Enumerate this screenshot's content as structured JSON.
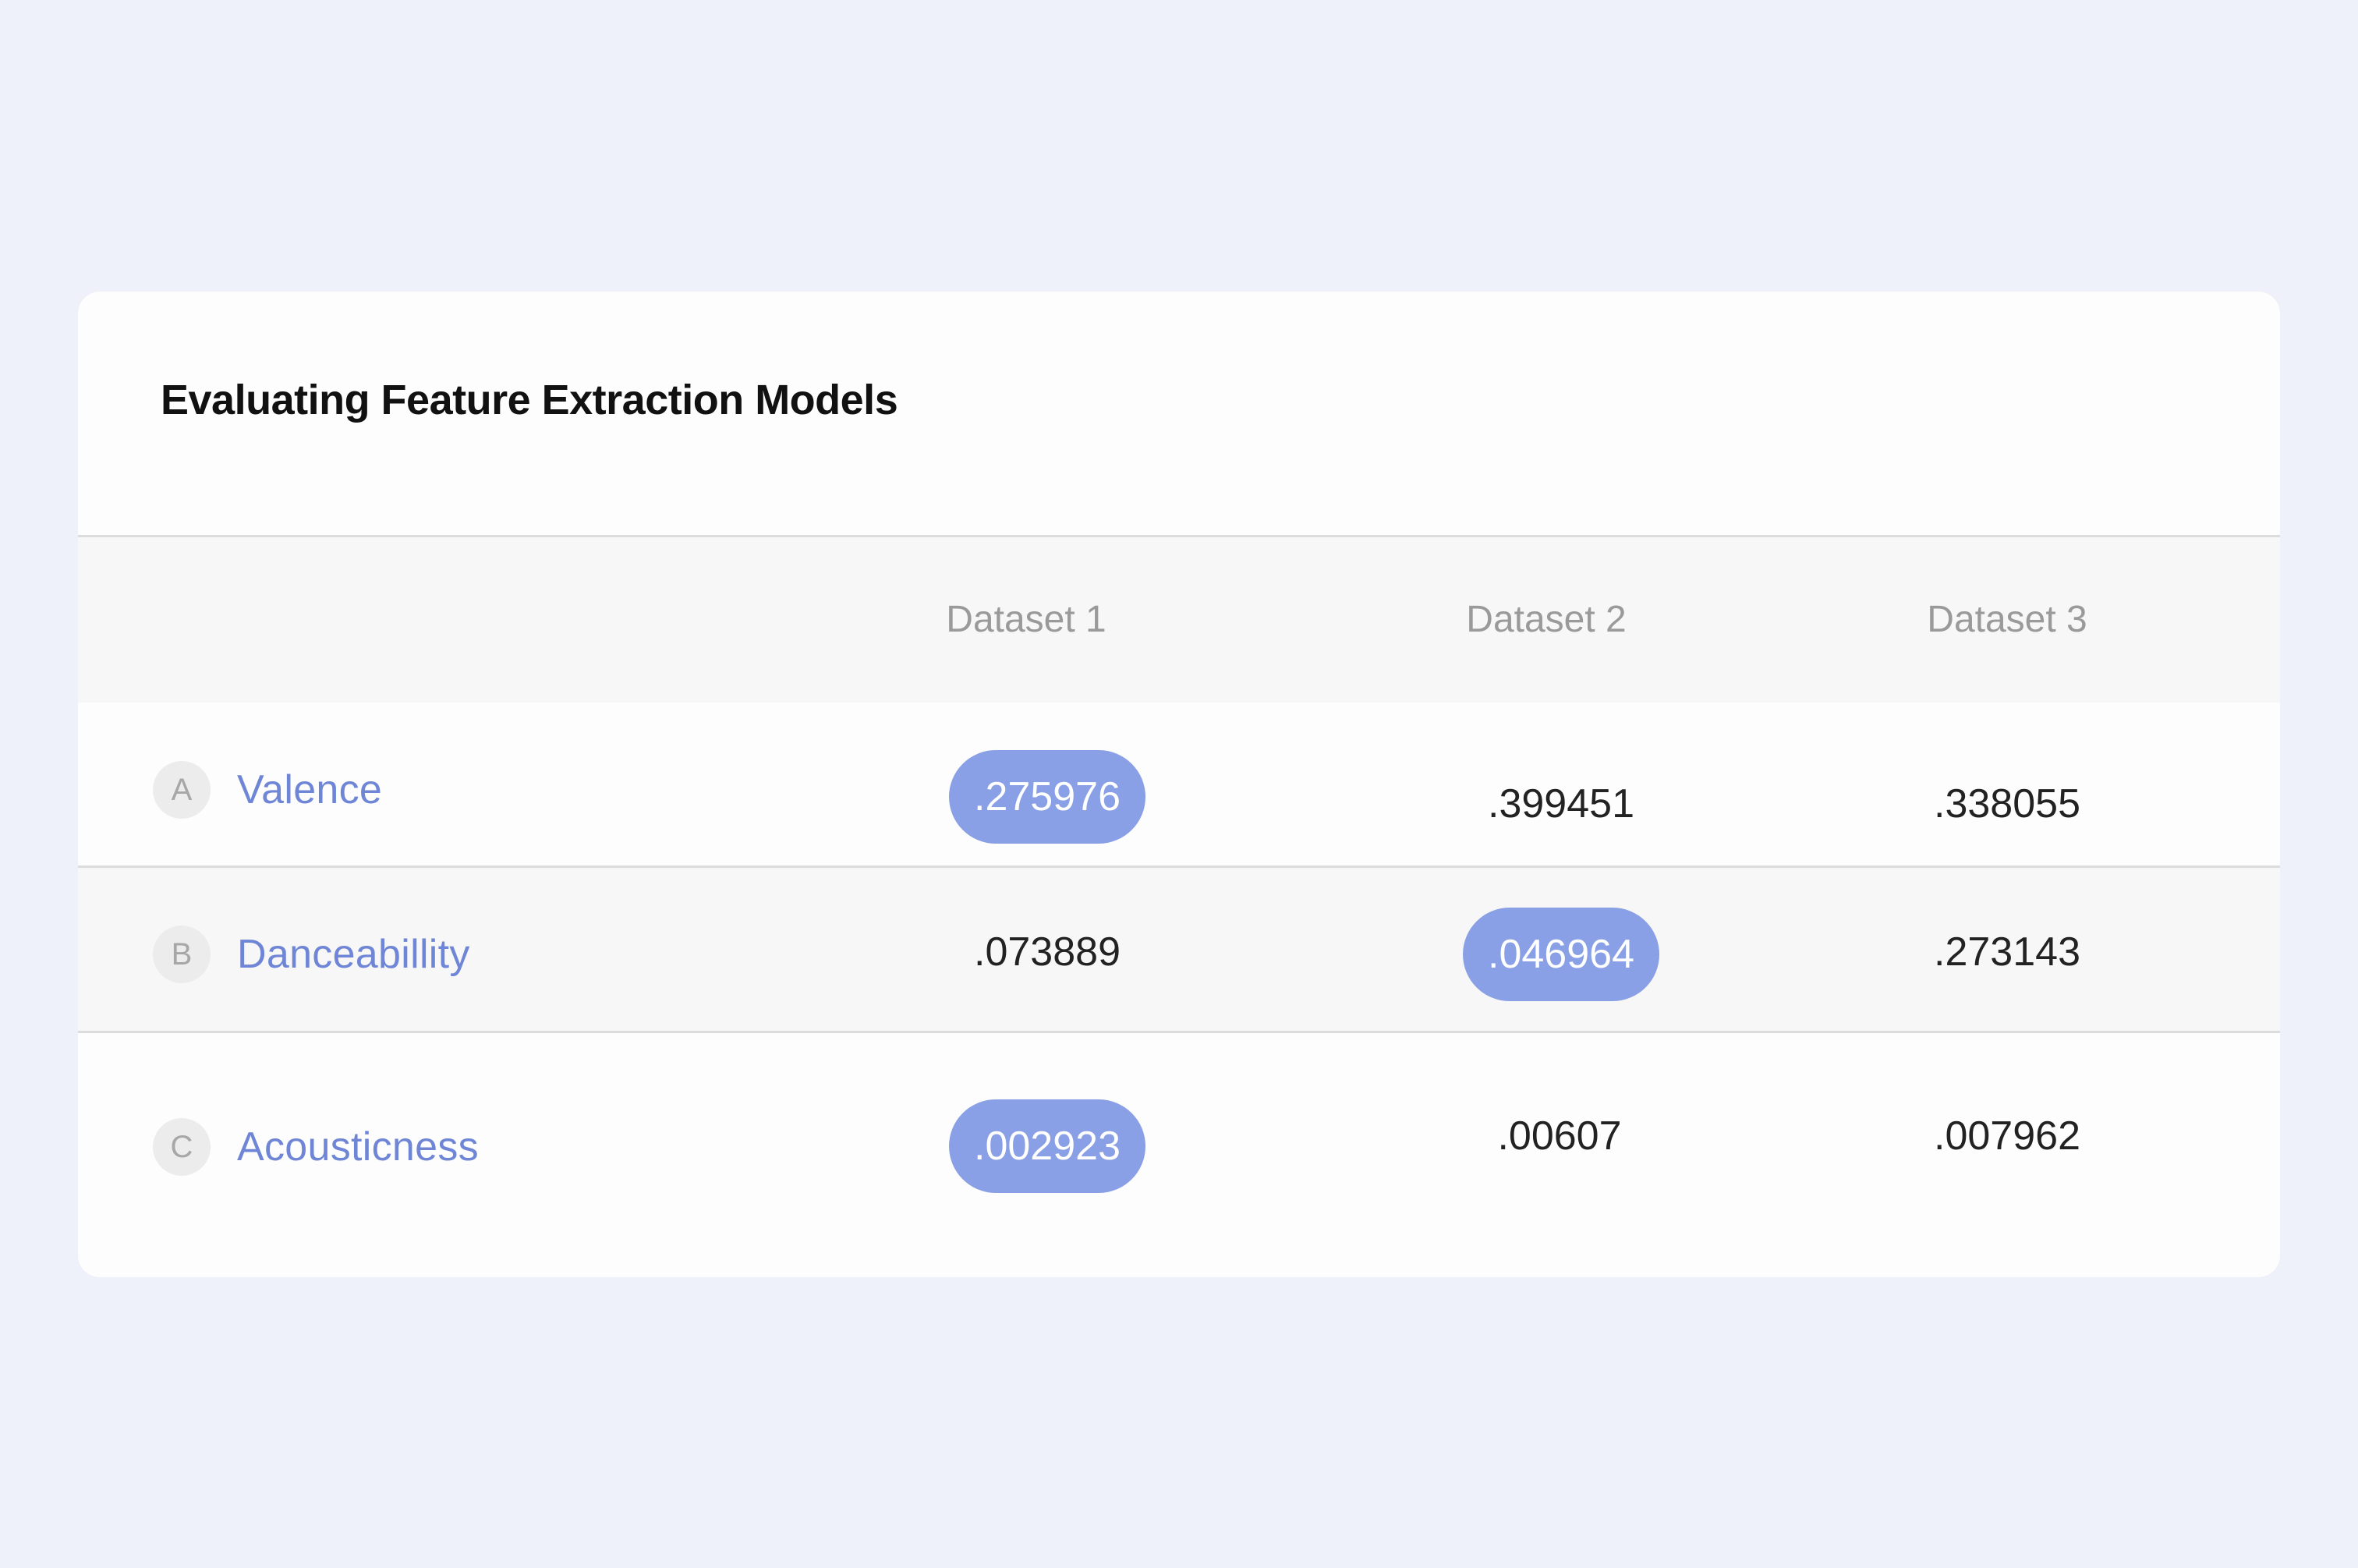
{
  "title": "Evaluating Feature Extraction Models",
  "columns": [
    "Dataset 1",
    "Dataset 2",
    "Dataset 3"
  ],
  "rows": [
    {
      "letter": "A",
      "label": "Valence",
      "values": [
        ".275976",
        ".399451",
        ".338055"
      ],
      "highlight": 0
    },
    {
      "letter": "B",
      "label": "Danceabillity",
      "values": [
        ".073889",
        ".046964",
        ".273143"
      ],
      "highlight": 1
    },
    {
      "letter": "C",
      "label": "Acousticness",
      "values": [
        ".002923",
        ".00607",
        ".007962"
      ],
      "highlight": 0
    }
  ],
  "colors": {
    "background": "#eef0fa",
    "card": "#fdfdfd",
    "accent": "#6f86d6",
    "highlight_pill": "#8aa0e6"
  }
}
